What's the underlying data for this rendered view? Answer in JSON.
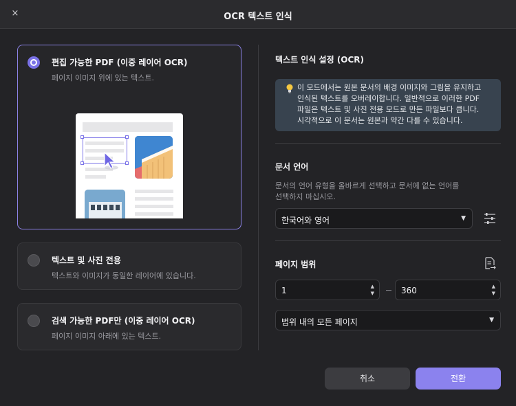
{
  "window": {
    "title": "OCR 텍스트 인식",
    "close_symbol": "×"
  },
  "modes": [
    {
      "title": "편집 가능한 PDF (이중 레이어 OCR)",
      "desc": "페이지 이미지 위에 있는 텍스트.",
      "selected": true
    },
    {
      "title": "텍스트 및 사진 전용",
      "desc": "텍스트와 이미지가 동일한 레이어에 있습니다.",
      "selected": false
    },
    {
      "title": "검색 가능한 PDF만 (이중 레이어 OCR)",
      "desc": "페이지 이미지 아래에 있는 텍스트.",
      "selected": false
    }
  ],
  "settings": {
    "title": "텍스트 인식 설정 (OCR)",
    "info_lines": [
      "이 모드에서는 원본 문서의 배경 이미지와 그림을 유지하고",
      "인식된 텍스트를 오버레이합니다. 일반적으로 이러한 PDF",
      "파일은 텍스트 및 사진 전용 모드로 만든 파일보다 큽니다.",
      "시각적으로 이 문서는 원본과 약간 다를 수 있습니다."
    ]
  },
  "language": {
    "title": "문서 언어",
    "desc_lines": [
      "문서의 언어 유형을 올바르게 선택하고 문서에 없는 언어를",
      "선택하지 마십시오."
    ],
    "selected": "한국어와 영어"
  },
  "page_range": {
    "title": "페이지 범위",
    "from": "1",
    "to": "360",
    "mode": "범위 내의 모든 페이지"
  },
  "buttons": {
    "cancel": "취소",
    "convert": "전환"
  },
  "colors": {
    "accent": "#8b82ee",
    "info_bg": "#38434f"
  }
}
